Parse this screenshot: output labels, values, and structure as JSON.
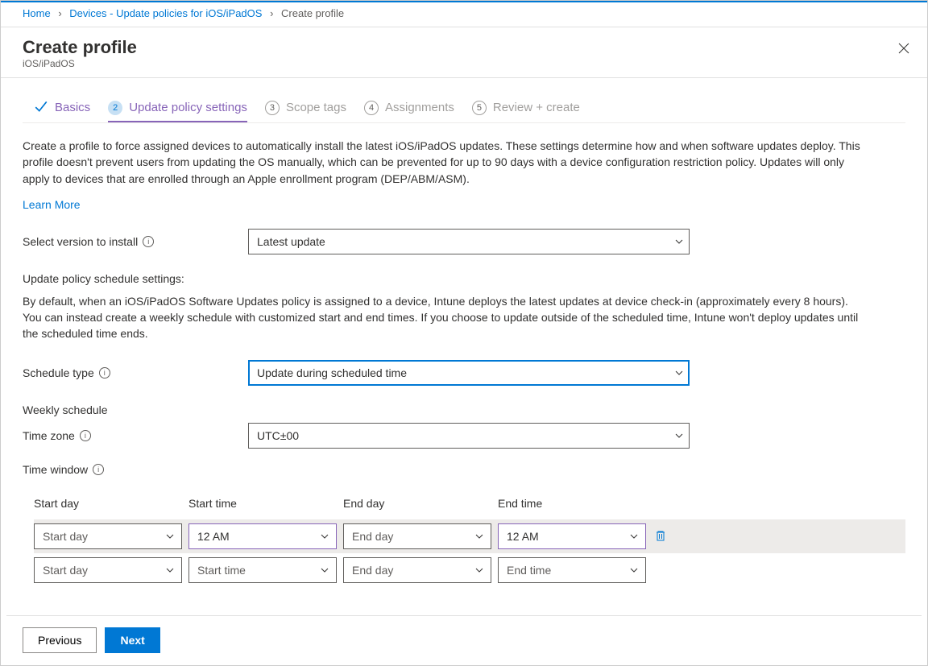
{
  "breadcrumb": {
    "home": "Home",
    "devices": "Devices - Update policies for iOS/iPadOS",
    "current": "Create profile"
  },
  "header": {
    "title": "Create profile",
    "subtitle": "iOS/iPadOS"
  },
  "tabs": {
    "basics": "Basics",
    "update": "Update policy settings",
    "scope": "Scope tags",
    "assign": "Assignments",
    "review": "Review + create",
    "num2": "2",
    "num3": "3",
    "num4": "4",
    "num5": "5"
  },
  "desc": "Create a profile to force assigned devices to automatically install the latest iOS/iPadOS updates. These settings determine how and when software updates deploy. This profile doesn't prevent users from updating the OS manually, which can be prevented for up to 90 days with a device configuration restriction policy. Updates will only apply to devices that are enrolled through an Apple enrollment program (DEP/ABM/ASM).",
  "learn_more": "Learn More",
  "labels": {
    "select_version": "Select version to install",
    "schedule_type": "Schedule type",
    "weekly_schedule": "Weekly schedule",
    "time_zone": "Time zone",
    "time_window": "Time window",
    "schedule_settings_title": "Update policy schedule settings:",
    "schedule_desc": "By default, when an iOS/iPadOS Software Updates policy is assigned to a device, Intune deploys the latest updates at device check-in (approximately every 8 hours). You can instead create a weekly schedule with customized start and end times. If you choose to update outside of the scheduled time, Intune won't deploy updates until the scheduled time ends."
  },
  "values": {
    "version": "Latest update",
    "schedule_type": "Update during scheduled time",
    "time_zone": "UTC±00"
  },
  "table": {
    "h_start_day": "Start day",
    "h_start_time": "Start time",
    "h_end_day": "End day",
    "h_end_time": "End time",
    "row1": {
      "start_day": "Start day",
      "start_time": "12 AM",
      "end_day": "End day",
      "end_time": "12 AM"
    },
    "row2": {
      "start_day": "Start day",
      "start_time": "Start time",
      "end_day": "End day",
      "end_time": "End time"
    }
  },
  "footer": {
    "previous": "Previous",
    "next": "Next"
  }
}
